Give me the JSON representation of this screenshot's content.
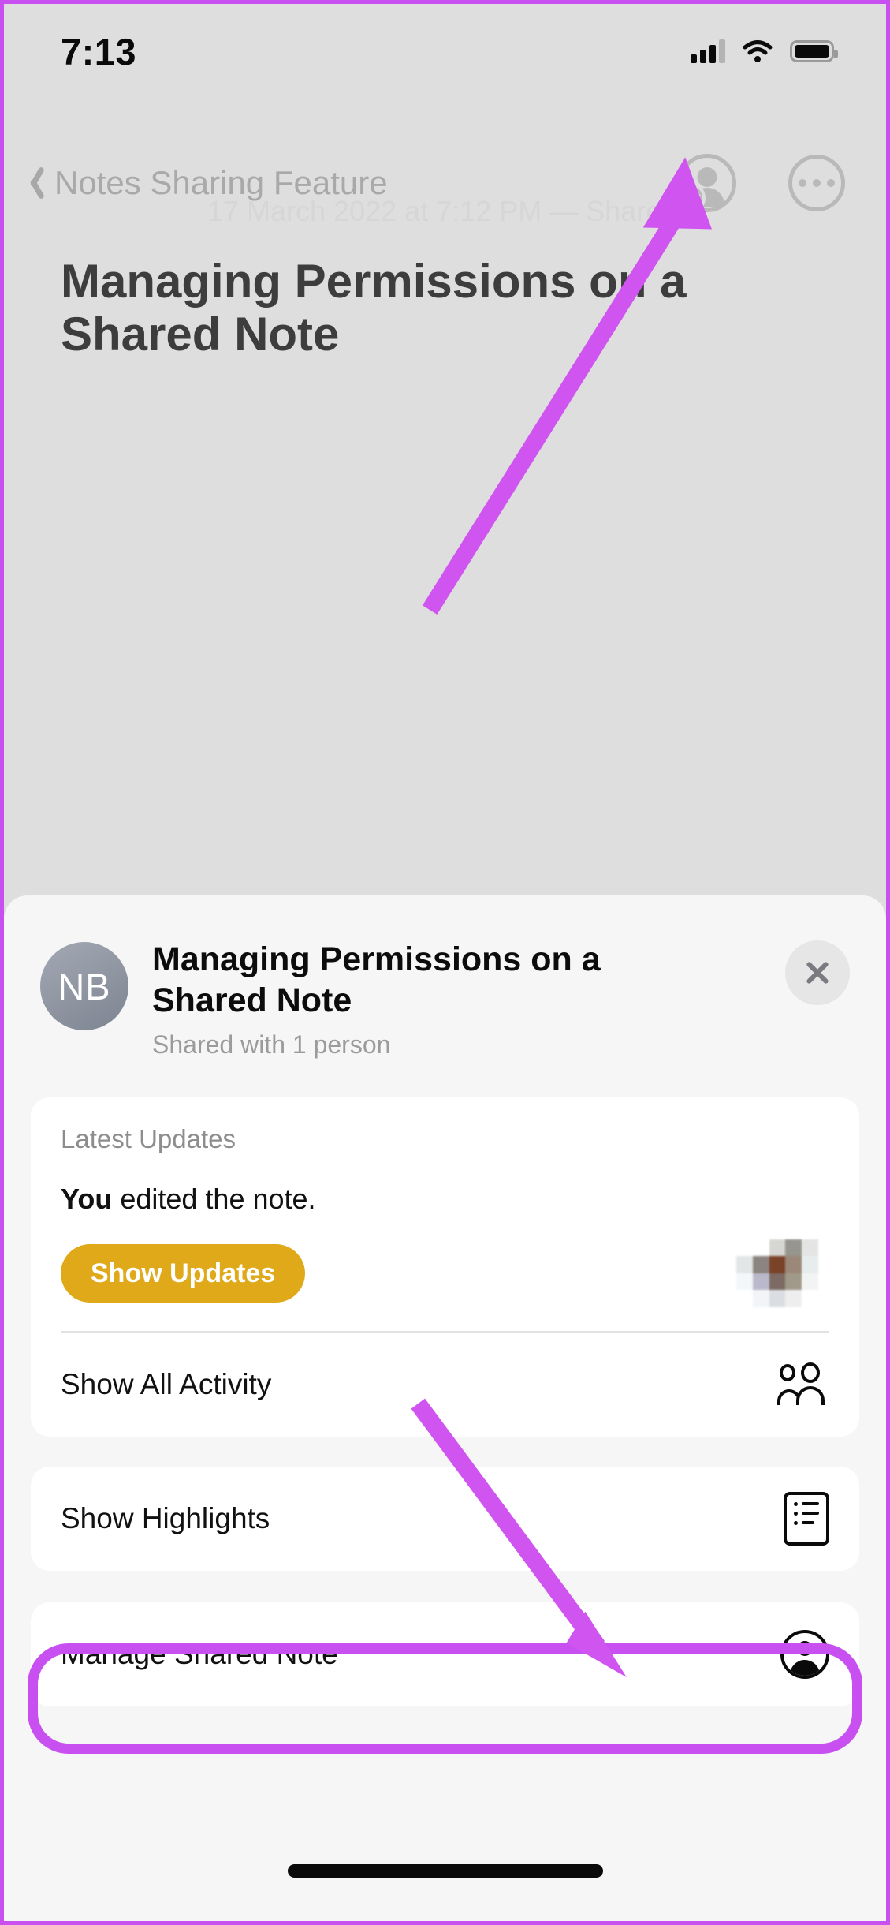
{
  "status_bar": {
    "time": "7:13",
    "cellular_icon": "signal-bars-icon",
    "wifi_icon": "wifi-icon",
    "battery_icon": "battery-icon"
  },
  "nav_bar": {
    "back_label": "Notes Sharing Feature",
    "back_icon": "chevron-left-icon",
    "collaboration_icon": "person-checkmark-icon",
    "more_icon": "ellipsis-circle-icon"
  },
  "note": {
    "meta": "17 March 2022 at 7:12 PM — Shared",
    "title": "Managing Permissions on a Shared Note"
  },
  "sheet": {
    "avatar_initials": "NB",
    "title": "Managing Permissions on a Shared Note",
    "subtitle": "Shared with 1 person",
    "close_icon": "close-icon",
    "updates": {
      "section_label": "Latest Updates",
      "message_actor": "You",
      "message_rest": " edited the note.",
      "button_label": "Show Updates",
      "thumbnail": "blurred-note-thumbnail"
    },
    "rows": [
      {
        "label": "Show All Activity",
        "icon": "people-icon"
      },
      {
        "label": "Show Highlights",
        "icon": "list-document-icon"
      },
      {
        "label": "Manage Shared Note",
        "icon": "person-circle-icon"
      }
    ]
  },
  "annotations": {
    "highlight_color": "#C84FF0",
    "arrow_color": "#D055F0",
    "arrow_to_collab_icon": "arrow-annotation",
    "arrow_to_manage_row": "arrow-annotation",
    "highlight_target": "Manage Shared Note"
  },
  "colors": {
    "page_background": "#DEDEDE",
    "sheet_background": "#F6F6F6",
    "card_background": "#FFFFFF",
    "accent_yellow": "#DFA91A",
    "magenta": "#C84FF0"
  },
  "home_indicator": "home-indicator"
}
